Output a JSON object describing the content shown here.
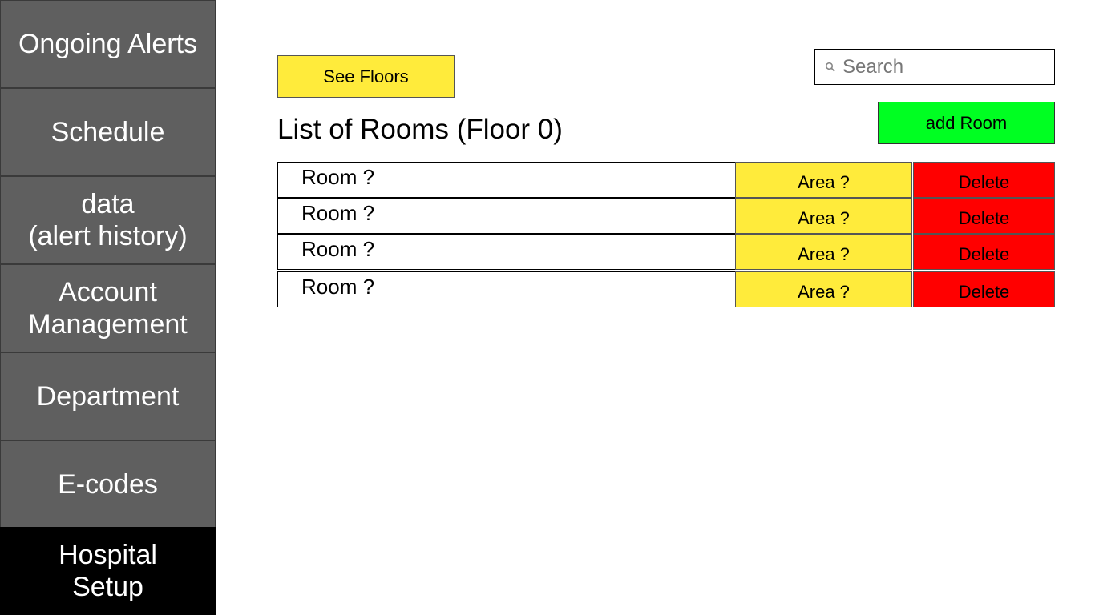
{
  "sidebar": {
    "items": [
      {
        "lines": [
          "Ongoing Alerts"
        ]
      },
      {
        "lines": [
          "Schedule"
        ]
      },
      {
        "lines": [
          "data",
          "(alert history)"
        ]
      },
      {
        "lines": [
          "Account",
          "Management"
        ]
      },
      {
        "lines": [
          "Department"
        ]
      },
      {
        "lines": [
          "E-codes"
        ]
      },
      {
        "lines": [
          "Hospital",
          "Setup"
        ],
        "active": true
      }
    ]
  },
  "toolbar": {
    "see_floors_label": "See Floors",
    "add_room_label": "add Room"
  },
  "search": {
    "placeholder": "Search",
    "value": ""
  },
  "main": {
    "title": "List of Rooms (Floor 0)"
  },
  "rooms": [
    {
      "name": "Room ?",
      "area_label": "Area ?",
      "delete_label": "Delete"
    },
    {
      "name": "Room ?",
      "area_label": "Area ?",
      "delete_label": "Delete"
    },
    {
      "name": "Room ?",
      "area_label": "Area ?",
      "delete_label": "Delete"
    },
    {
      "name": "Room ?",
      "area_label": "Area ?",
      "delete_label": "Delete"
    }
  ],
  "colors": {
    "sidebar_bg": "#5f5f5f",
    "sidebar_active_bg": "#000000",
    "yellow_button": "#ffeb3b",
    "add_button": "#00ff22",
    "delete_button": "#ff0000"
  },
  "icons": {
    "search": "search-icon"
  }
}
